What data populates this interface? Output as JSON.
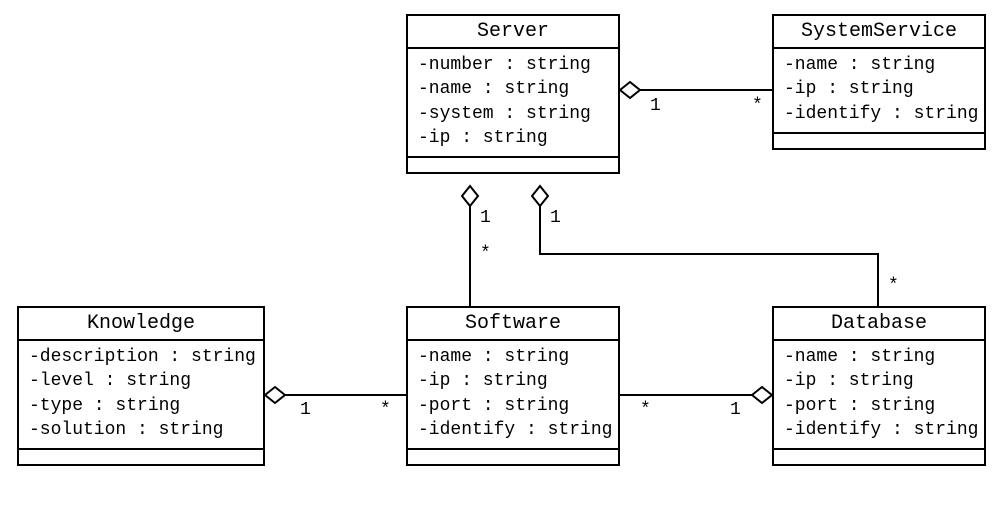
{
  "classes": {
    "server": {
      "name": "Server",
      "attrs": [
        "-number : string",
        "-name : string",
        "-system : string",
        "-ip : string"
      ]
    },
    "systemservice": {
      "name": "SystemService",
      "attrs": [
        "-name : string",
        "-ip : string",
        "-identify : string"
      ]
    },
    "knowledge": {
      "name": "Knowledge",
      "attrs": [
        "-description : string",
        "-level : string",
        "-type : string",
        "-solution : string"
      ]
    },
    "software": {
      "name": "Software",
      "attrs": [
        "-name : string",
        "-ip : string",
        "-port : string",
        "-identify : string"
      ]
    },
    "database": {
      "name": "Database",
      "attrs": [
        "-name : string",
        "-ip : string",
        "-port : string",
        "-identify : string"
      ]
    }
  },
  "mult": {
    "server_sysservice_1": "1",
    "server_sysservice_star": "*",
    "server_software_1": "1",
    "server_software_star": "*",
    "server_database_1": "1",
    "server_database_star": "*",
    "software_knowledge_1": "1",
    "software_knowledge_star": "*",
    "database_software_1": "1",
    "database_software_star": "*"
  }
}
